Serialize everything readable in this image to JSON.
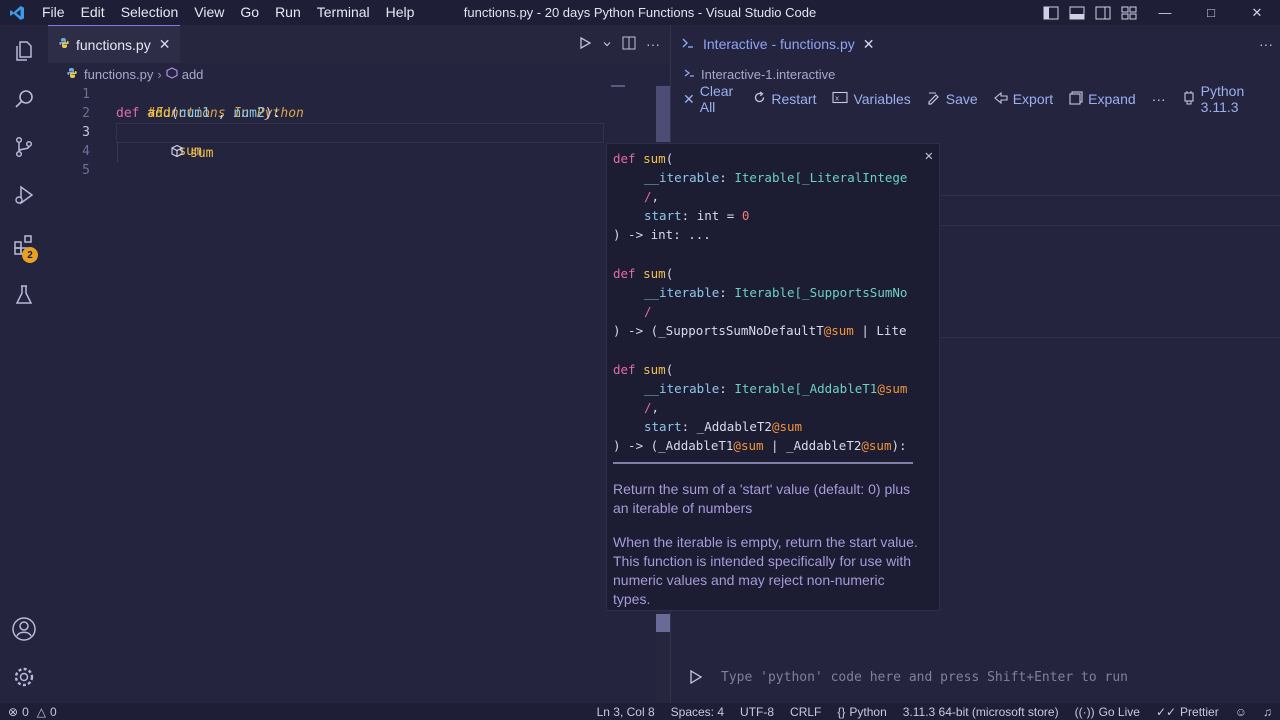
{
  "titlebar": {
    "menus": [
      "File",
      "Edit",
      "Selection",
      "View",
      "Go",
      "Run",
      "Terminal",
      "Help"
    ],
    "title": "functions.py - 20 days Python Functions - Visual Studio Code"
  },
  "activity": {
    "extensions_badge": "2"
  },
  "editor": {
    "tab_label": "functions.py",
    "breadcrumb": {
      "file": "functions.py",
      "symbol": "add"
    },
    "line_numbers": [
      "1",
      "2",
      "3",
      "4",
      "5"
    ],
    "lines": {
      "l1": "#Functions In Python",
      "l2_kw": "def",
      "l2_fn": "add",
      "l2_open": "(",
      "l2_p1": "num1",
      "l2_comma": " , ",
      "l2_p2": "num2",
      "l2_close": "):",
      "l3": "sum"
    },
    "suggestion": "sum"
  },
  "hover": {
    "sig1": {
      "def": "def",
      "fn": "sum",
      "open": "(",
      "p": "__iterable",
      "colon": ": ",
      "type": "Iterable[_LiteralIntege",
      "slash": "/",
      "slash_comma": ",",
      "start": "start",
      "start_type": ": int = ",
      "start_val": "0",
      "ret": ") -> int: ..."
    },
    "sig2": {
      "def": "def",
      "fn": "sum",
      "open": "(",
      "p": "__iterable",
      "colon": ": ",
      "type": "Iterable[_SupportsSumNo",
      "slash": "/",
      "ret_a": ") -> (_SupportsSumNoDefaultT",
      "ret_at": "@sum",
      "ret_b": " | Lite"
    },
    "sig3": {
      "def": "def",
      "fn": "sum",
      "open": "(",
      "p": "__iterable",
      "colon": ": ",
      "type": "Iterable[_AddableT1",
      "type_at": "@sum",
      "slash": "/",
      "slash_comma": ",",
      "start": "start",
      "start_colon": ": ",
      "start_type": "_AddableT2",
      "start_at": "@sum",
      "ret_a": ") -> (_AddableT1",
      "ret_at1": "@sum",
      "ret_b": " | _AddableT2",
      "ret_at2": "@sum",
      "ret_c": "):"
    },
    "doc1": "Return the sum of a 'start' value (default: 0) plus an iterable of numbers",
    "doc2": "When the iterable is empty, return the start value. This function is intended specifically for use with numeric values and may reject non-numeric types."
  },
  "interactive": {
    "tab_label": "Interactive - functions.py",
    "crumb": "Interactive-1.interactive",
    "toolbar": {
      "clear_all": "Clear All",
      "restart": "Restart",
      "variables": "Variables",
      "save": "Save",
      "export": "Export",
      "expand": "Expand",
      "more": "···",
      "kernel": "Python 3.11.3"
    },
    "input_placeholder": "Type 'python' code here and press Shift+Enter to run"
  },
  "statusbar": {
    "errors": "0",
    "warnings": "0",
    "position": "Ln 3, Col 8",
    "spaces": "Spaces: 4",
    "encoding": "UTF-8",
    "eol": "CRLF",
    "language": "Python",
    "interpreter": "3.11.3 64-bit (microsoft store)",
    "golive": "Go Live",
    "prettier": "Prettier"
  },
  "colors": {
    "accent": "#8a78e6",
    "background": "#24243e",
    "keyword": "#e46aa6",
    "function": "#f0c04d",
    "comment": "#d8a74d"
  }
}
